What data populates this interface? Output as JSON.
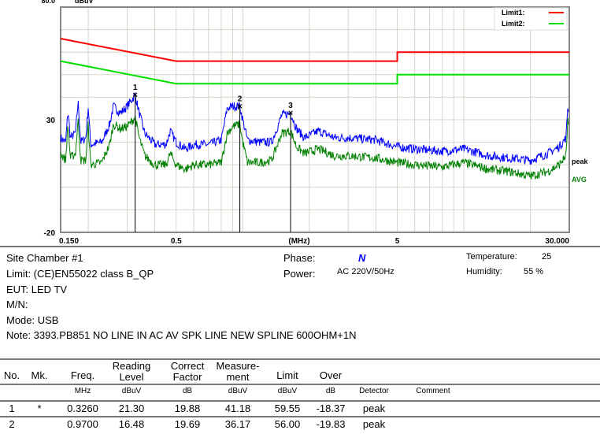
{
  "chart_data": {
    "type": "line",
    "title": "",
    "ylabel": "dBuV",
    "xlabel": "(MHz)",
    "x_scale": "log",
    "xlim": [
      0.15,
      30
    ],
    "ylim": [
      -20,
      80
    ],
    "y_top_label": "80.0",
    "y_ticks": [
      "30",
      "-20"
    ],
    "x_ticks": [
      {
        "v": 0.15,
        "label": "0.150"
      },
      {
        "v": 0.5,
        "label": "0.5"
      },
      {
        "v": 1.8,
        "label": "(MHz)"
      },
      {
        "v": 5,
        "label": "5"
      },
      {
        "v": 30,
        "label": "30.000"
      }
    ],
    "grid": true,
    "legend_placement": "top-right",
    "limits": [
      {
        "name": "Limit1:",
        "color": "#ff0000",
        "points": [
          [
            0.15,
            66
          ],
          [
            0.5,
            56
          ],
          [
            5,
            56
          ],
          [
            5,
            60
          ],
          [
            30,
            60
          ]
        ]
      },
      {
        "name": "Limit2:",
        "color": "#00e000",
        "points": [
          [
            0.15,
            56
          ],
          [
            0.5,
            46
          ],
          [
            5,
            46
          ],
          [
            5,
            50
          ],
          [
            30,
            50
          ]
        ]
      }
    ],
    "series": [
      {
        "name": "peak",
        "color": "#0000ff",
        "points": [
          [
            0.15,
            22
          ],
          [
            0.158,
            20
          ],
          [
            0.162,
            34
          ],
          [
            0.166,
            22
          ],
          [
            0.175,
            24
          ],
          [
            0.18,
            38
          ],
          [
            0.185,
            20
          ],
          [
            0.195,
            22
          ],
          [
            0.2,
            36
          ],
          [
            0.205,
            19
          ],
          [
            0.23,
            20
          ],
          [
            0.25,
            28
          ],
          [
            0.26,
            36
          ],
          [
            0.28,
            33
          ],
          [
            0.3,
            36
          ],
          [
            0.326,
            41
          ],
          [
            0.34,
            33
          ],
          [
            0.36,
            24
          ],
          [
            0.4,
            19
          ],
          [
            0.45,
            19
          ],
          [
            0.47,
            25
          ],
          [
            0.5,
            20
          ],
          [
            0.55,
            17
          ],
          [
            0.6,
            19
          ],
          [
            0.7,
            19
          ],
          [
            0.8,
            21
          ],
          [
            0.85,
            35
          ],
          [
            0.9,
            36
          ],
          [
            0.97,
            36
          ],
          [
            1.0,
            30
          ],
          [
            1.05,
            21
          ],
          [
            1.2,
            20
          ],
          [
            1.35,
            20
          ],
          [
            1.45,
            28
          ],
          [
            1.5,
            32
          ],
          [
            1.646,
            33
          ],
          [
            1.75,
            26
          ],
          [
            1.9,
            22
          ],
          [
            2.2,
            25
          ],
          [
            2.6,
            22
          ],
          [
            3,
            22
          ],
          [
            4,
            21
          ],
          [
            5,
            18
          ],
          [
            6,
            17
          ],
          [
            8,
            16
          ],
          [
            10,
            17
          ],
          [
            13,
            14
          ],
          [
            16,
            13
          ],
          [
            20,
            12
          ],
          [
            24,
            15
          ],
          [
            27,
            18
          ],
          [
            29,
            22
          ],
          [
            29.6,
            38
          ],
          [
            30,
            22
          ]
        ]
      },
      {
        "name": "AVG",
        "color": "#008000",
        "points": [
          [
            0.15,
            15
          ],
          [
            0.158,
            12
          ],
          [
            0.162,
            28
          ],
          [
            0.166,
            13
          ],
          [
            0.175,
            15
          ],
          [
            0.18,
            30
          ],
          [
            0.185,
            12
          ],
          [
            0.195,
            12
          ],
          [
            0.2,
            28
          ],
          [
            0.205,
            10
          ],
          [
            0.23,
            11
          ],
          [
            0.25,
            19
          ],
          [
            0.26,
            28
          ],
          [
            0.28,
            26
          ],
          [
            0.3,
            27
          ],
          [
            0.326,
            31
          ],
          [
            0.34,
            22
          ],
          [
            0.36,
            14
          ],
          [
            0.4,
            10
          ],
          [
            0.45,
            10
          ],
          [
            0.47,
            15
          ],
          [
            0.5,
            10
          ],
          [
            0.55,
            8
          ],
          [
            0.6,
            10
          ],
          [
            0.7,
            10
          ],
          [
            0.8,
            11
          ],
          [
            0.85,
            24
          ],
          [
            0.9,
            27
          ],
          [
            0.97,
            28
          ],
          [
            1.0,
            20
          ],
          [
            1.05,
            11
          ],
          [
            1.2,
            11
          ],
          [
            1.35,
            12
          ],
          [
            1.45,
            20
          ],
          [
            1.5,
            24
          ],
          [
            1.646,
            25
          ],
          [
            1.75,
            18
          ],
          [
            1.9,
            15
          ],
          [
            2.2,
            17
          ],
          [
            2.6,
            14
          ],
          [
            3,
            14
          ],
          [
            4,
            13
          ],
          [
            5,
            11
          ],
          [
            6,
            10
          ],
          [
            8,
            9
          ],
          [
            10,
            11
          ],
          [
            13,
            8
          ],
          [
            16,
            7
          ],
          [
            20,
            5
          ],
          [
            24,
            7
          ],
          [
            27,
            10
          ],
          [
            29,
            14
          ],
          [
            29.6,
            32
          ],
          [
            30,
            12
          ]
        ]
      }
    ],
    "markers": [
      {
        "label": "1",
        "freq": 0.326,
        "level": 41.18
      },
      {
        "label": "2",
        "freq": 0.97,
        "level": 36.17
      },
      {
        "label": "3",
        "freq": 1.646,
        "level": 33.1
      }
    ]
  },
  "info": {
    "site": "Site  Chamber #1",
    "limit": "Limit:  (CE)EN55022 class B_QP",
    "eut": "EUT:  LED TV",
    "mn": "M/N:",
    "mode": "Mode:  USB",
    "note": "Note:  3393.PB851 NO LINE IN    AC  AV SPK LINE NEW SPLINE 600OHM+1N",
    "phase_label": "Phase:",
    "phase_value": "N",
    "power_label": "Power:",
    "power_value": "AC 220V/50Hz",
    "temp_label": "Temperature:",
    "temp_value": "25",
    "hum_label": "Humidity:",
    "hum_value": "55 %"
  },
  "table": {
    "headers": [
      "No.",
      "Mk.",
      "Freq.",
      "Reading\nLevel",
      "Correct\nFactor",
      "Measure-\nment",
      "Limit",
      "Over",
      "",
      ""
    ],
    "units": [
      "",
      "",
      "MHz",
      "dBuV",
      "dB",
      "dBuV",
      "dBuV",
      "dB",
      "Detector",
      "Comment"
    ],
    "rows": [
      [
        "1",
        "*",
        "0.3260",
        "21.30",
        "19.88",
        "41.18",
        "59.55",
        "-18.37",
        "peak",
        ""
      ],
      [
        "2",
        "",
        "0.9700",
        "16.48",
        "19.69",
        "36.17",
        "56.00",
        "-19.83",
        "peak",
        ""
      ]
    ]
  }
}
